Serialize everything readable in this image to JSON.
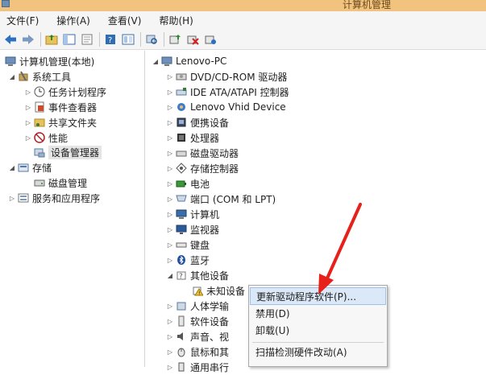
{
  "window": {
    "title": "计算机管理"
  },
  "menu": [
    "文件(F)",
    "操作(A)",
    "查看(V)",
    "帮助(H)"
  ],
  "toolbar": {
    "icons": [
      "back-icon",
      "forward-icon",
      "up-folder-icon",
      "show-hide-tree-icon",
      "properties-icon",
      "help-icon",
      "console-tree-icon",
      "scan-icon",
      "update-driver-icon",
      "disable-icon",
      "uninstall-icon"
    ]
  },
  "left_tree": {
    "root": "计算机管理(本地)",
    "system_tools": "系统工具",
    "task_scheduler": "任务计划程序",
    "event_viewer": "事件查看器",
    "shared_folders": "共享文件夹",
    "performance": "性能",
    "device_manager": "设备管理器",
    "storage": "存储",
    "disk_management": "磁盘管理",
    "services_apps": "服务和应用程序"
  },
  "device_tree": {
    "root": "Lenovo-PC",
    "items": [
      "DVD/CD-ROM 驱动器",
      "IDE ATA/ATAPI 控制器",
      "Lenovo Vhid Device",
      "便携设备",
      "处理器",
      "磁盘驱动器",
      "存储控制器",
      "电池",
      "端口 (COM 和 LPT)",
      "计算机",
      "监视器",
      "键盘",
      "蓝牙",
      "其他设备",
      "未知设备",
      "人体学输",
      "软件设备",
      "声音、视",
      "鼠标和其",
      "通用串行"
    ]
  },
  "context_menu": {
    "update": "更新驱动程序软件(P)...",
    "disable": "禁用(D)",
    "uninstall": "卸载(U)",
    "scan": "扫描检测硬件改动(A)"
  },
  "colors": {
    "title_bar": "#f1c37f",
    "annotation_arrow": "#e8201a",
    "highlight": "#dbe8f7"
  }
}
